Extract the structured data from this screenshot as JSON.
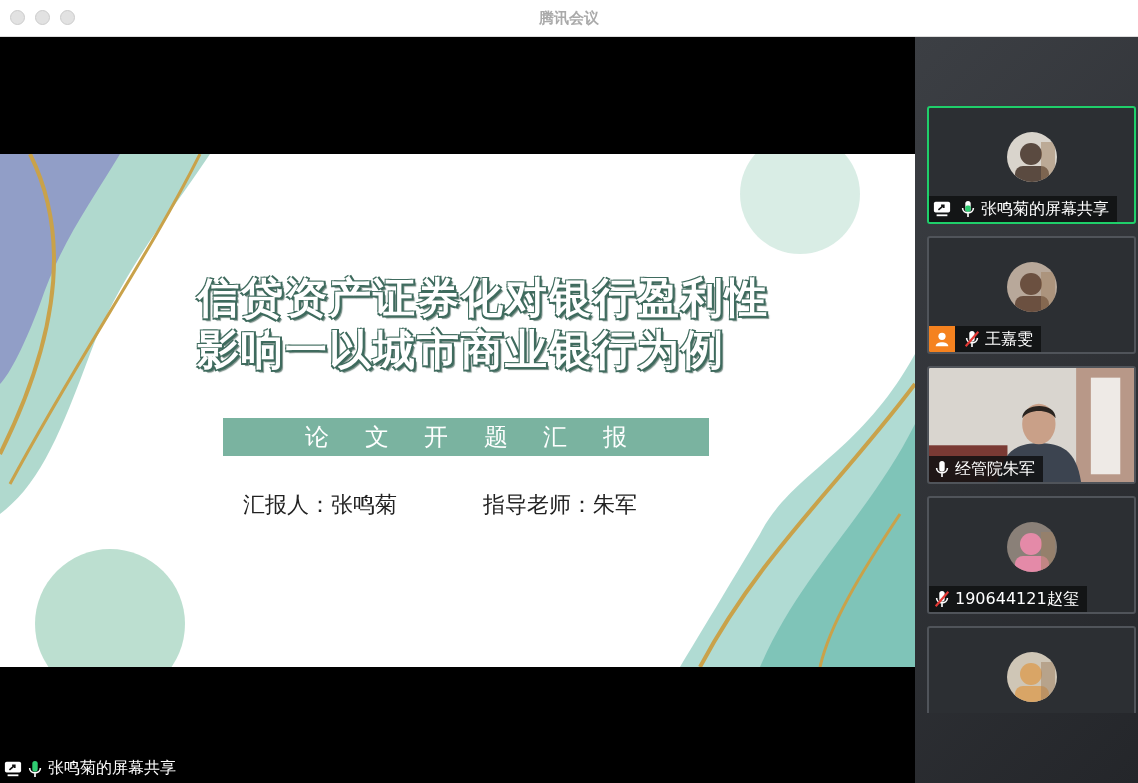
{
  "window": {
    "title": "腾讯会议"
  },
  "slide": {
    "title_lines": [
      "信贷资产证券化对银行盈利性",
      "影响一以城市商业银行为例"
    ],
    "banner": "论 文 开 题 汇 报",
    "presenter": "汇报人：张鸣菊",
    "advisor": "指导老师：朱军"
  },
  "share_label": {
    "name": "张鸣菊的屏幕共享",
    "sharing": true,
    "muted": false,
    "speaking": true
  },
  "participants": [
    {
      "kind": "avatar",
      "name": "张鸣菊的屏幕共享",
      "selected": true,
      "sharing": true,
      "muted": false,
      "speaking": true
    },
    {
      "kind": "avatar",
      "name": "王嘉雯",
      "selected": false,
      "badge": true,
      "muted": true
    },
    {
      "kind": "video",
      "name": "经管院朱军",
      "selected": false,
      "muted": false,
      "speaking": false
    },
    {
      "kind": "avatar",
      "name": "190644121赵玺",
      "selected": false,
      "muted": true
    },
    {
      "kind": "avatar",
      "selected": false
    }
  ]
}
